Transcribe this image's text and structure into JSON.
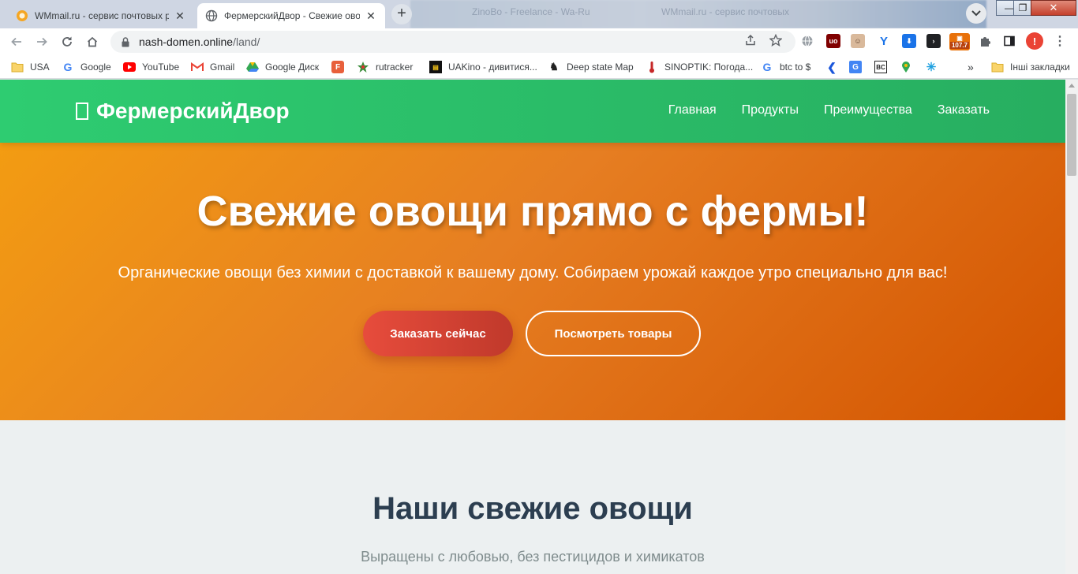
{
  "browser": {
    "tabs": [
      {
        "title": "WMmail.ru - сервис почтовых р",
        "active": false
      },
      {
        "title": "ФермерскийДвор - Свежие ово",
        "active": true
      }
    ],
    "ghost_tabs": [
      "ZinoBo - Freelance - Wa-Ru",
      "WMmail.ru - сервис почтовых"
    ],
    "url_host": "nash-domen.online",
    "url_path": "/land/",
    "extension_badge": "107.7",
    "profile_initial": "!",
    "accent": "#e8710a"
  },
  "bookmarks": [
    {
      "label": "USA",
      "icon": "folder-icon"
    },
    {
      "label": "Google",
      "icon": "google-icon"
    },
    {
      "label": "YouTube",
      "icon": "youtube-icon"
    },
    {
      "label": "Gmail",
      "icon": "gmail-icon"
    },
    {
      "label": "Google Диск",
      "icon": "google-drive-icon"
    },
    {
      "label": "",
      "icon": "f-app-icon"
    },
    {
      "label": "rutracker",
      "icon": "rutracker-icon"
    },
    {
      "label": "UAKino - дивитися...",
      "icon": "uakino-icon"
    },
    {
      "label": "Deep state Map",
      "icon": "deepstate-icon"
    },
    {
      "label": "SINOPTIK: Погода...",
      "icon": "thermometer-icon"
    },
    {
      "label": "btc to $",
      "icon": "google-icon"
    }
  ],
  "bookmarks_more": "»",
  "bookmarks_other": "Інші закладки",
  "site": {
    "logo_text": "ФермерскийДвор",
    "nav": [
      "Главная",
      "Продукты",
      "Преимущества",
      "Заказать"
    ],
    "hero_title": "Свежие овощи прямо с фермы!",
    "hero_subtitle": "Органические овощи без химии с доставкой к вашему дому. Собираем урожай каждое утро специально для вас!",
    "cta_primary": "Заказать сейчас",
    "cta_secondary": "Посмотреть товары",
    "section_title": "Наши свежие овощи",
    "section_subtitle": "Выращены с любовью, без пестицидов и химикатов",
    "colors": {
      "header_start": "#2ecc71",
      "header_end": "#27ae60",
      "hero_start": "#f39c12",
      "hero_end": "#d35400",
      "cta_primary": "#e74c3c",
      "section_title": "#2c3e50"
    }
  }
}
